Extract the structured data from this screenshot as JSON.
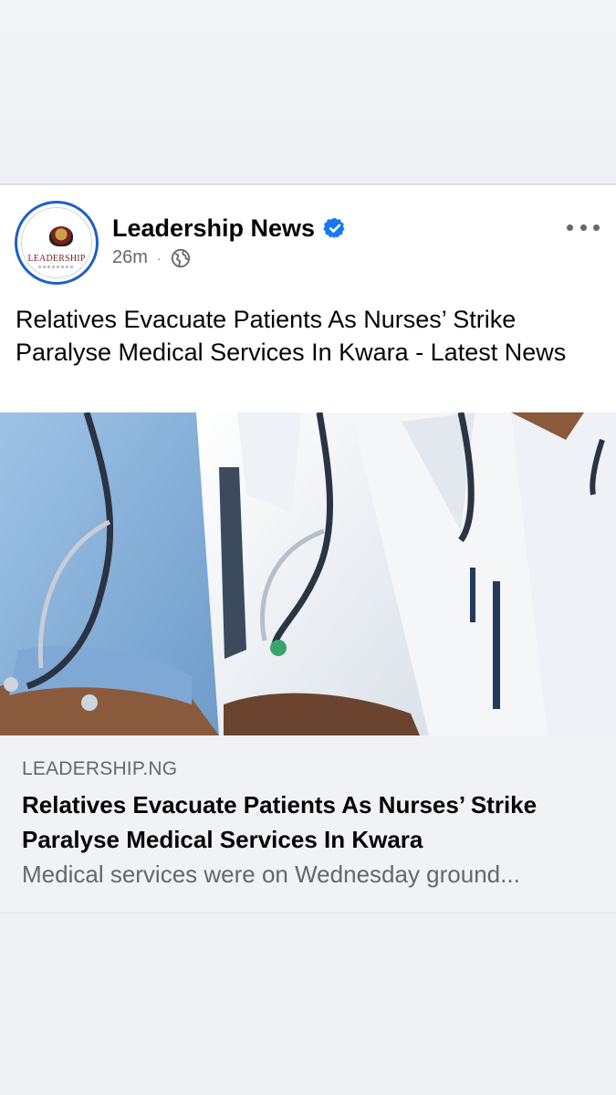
{
  "post": {
    "page_name": "Leadership News",
    "avatar_text": "LEADERSHIP",
    "time_ago": "26m",
    "separator": "·",
    "audience_icon": "globe-icon",
    "verified_icon": "verified-badge-icon",
    "more_icon": "more-options-icon",
    "body_text": "Relatives Evacuate Patients As Nurses’ Strike Paralyse Medical Services In Kwara - Latest News",
    "image_icon": "medical-staff-photo"
  },
  "link_preview": {
    "domain": "LEADERSHIP.NG",
    "title": "Relatives Evacuate Patients As Nurses’ Strike Paralyse Medical Services In Kwara",
    "description": "Medical services were on Wednesday ground..."
  },
  "colors": {
    "verified_blue": "#1877f2",
    "secondary_text": "#65676b",
    "primary_text": "#050505",
    "link_box_bg": "#f0f2f5"
  }
}
